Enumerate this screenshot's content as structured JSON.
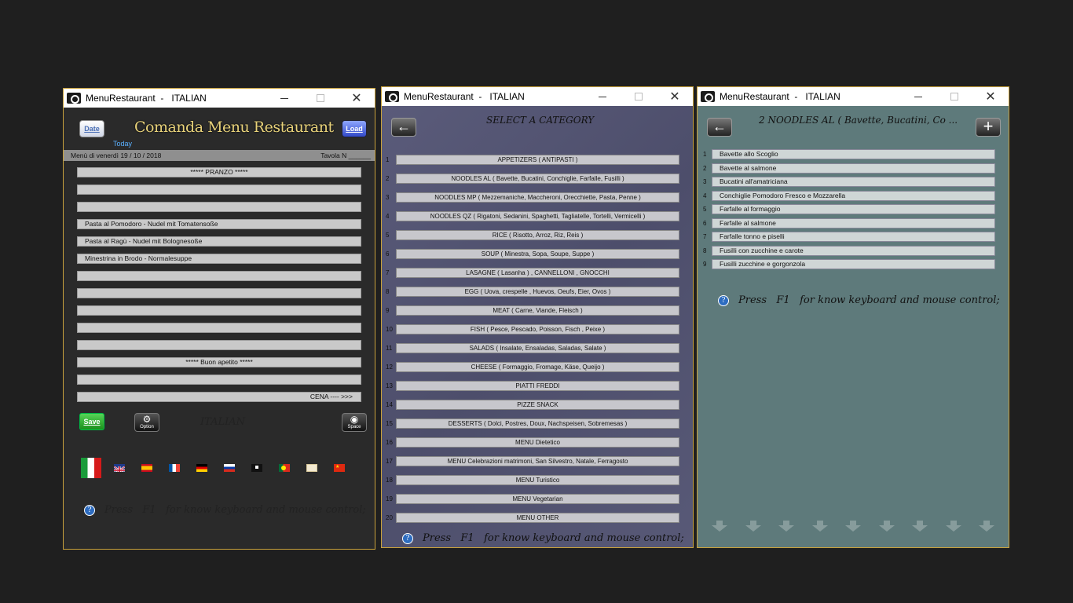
{
  "window_left": {
    "title": "MenuRestaurant  -   ITALIAN",
    "date_button": "Date",
    "load_button": "Load",
    "app_title": "Comanda Menu Restaurant",
    "today_label": "Today",
    "info_left": "Menù di  venerdì  19 / 10 / 2018",
    "info_right": "Tavola N ______",
    "menu_lines": [
      "***** PRANZO *****",
      "",
      "",
      "Pasta al Pomodoro - Nudel mit Tomatensoße",
      "Pasta al Ragù - Nudel mit Bolognesoße",
      "Minestrina in Brodo - Normalesuppe",
      "",
      "",
      "",
      "",
      "",
      "*****  Buon apetito  *****",
      "",
      "CENA  ---- >>>"
    ],
    "save_button": "Save",
    "option_button": "Option",
    "space_button": "Space",
    "language_label": "ITALIAN",
    "flags": [
      "italy-flag",
      "uk-flag",
      "spain-flag",
      "france-flag",
      "germany-flag",
      "russia-flag",
      "arabic-flag",
      "portugal-flag",
      "greece-flag",
      "china-flag"
    ],
    "help_text": "Press   F1   for know keyboard and mouse control;"
  },
  "window_middle": {
    "title": "MenuRestaurant  -   ITALIAN",
    "heading": "SELECT A CATEGORY",
    "categories": [
      {
        "num": "1",
        "label": "APPETIZERS ( ANTIPASTI )"
      },
      {
        "num": "2",
        "label": "NOODLES  AL  ( Bavette, Bucatini, Conchiglie, Farfalle, Fusilli )"
      },
      {
        "num": "3",
        "label": "NOODLES  MP  ( Mezzemaniche, Maccheroni, Orecchiette, Pasta, Penne )"
      },
      {
        "num": "4",
        "label": "NOODLES  QZ  ( Rigatoni, Sedanini, Spaghetti, Tagliatelle, Tortelli, Vermicelli )"
      },
      {
        "num": "5",
        "label": "RICE ( Risotto, Arroz, Riz, Reis )"
      },
      {
        "num": "6",
        "label": "SOUP ( Minestra, Sopa, Soupe, Suppe )"
      },
      {
        "num": "7",
        "label": "LASAGNE ( Lasanha ) , CANNELLONI  , GNOCCHI"
      },
      {
        "num": "8",
        "label": "EGG ( Uova, crespelle , Huevos, Oeufs, Eier, Ovos )"
      },
      {
        "num": "9",
        "label": "MEAT   ( Carne, Viande, Fleisch )"
      },
      {
        "num": "10",
        "label": "FISH   ( Pesce, Pescado, Poisson, Fisch , Peixe )"
      },
      {
        "num": "11",
        "label": "SALADS ( Insalate, Ensaladas, Saladas, Salate )"
      },
      {
        "num": "12",
        "label": "CHEESE ( Formaggio, Fromage, Käse, Queijo )"
      },
      {
        "num": "13",
        "label": "PIATTI FREDDI"
      },
      {
        "num": "14",
        "label": "PIZZE  SNACK"
      },
      {
        "num": "15",
        "label": "DESSERTS ( Dolci, Postres, Doux, Nachspeisen, Sobremesas )"
      },
      {
        "num": "16",
        "label": "MENU Dietetico"
      },
      {
        "num": "17",
        "label": "MENU Celebrazioni  matrimoni, San Silvestro, Natale, Ferragosto"
      },
      {
        "num": "18",
        "label": "MENU Turistico"
      },
      {
        "num": "19",
        "label": "MENU Vegetarian"
      },
      {
        "num": "20",
        "label": "MENU OTHER"
      }
    ],
    "help_text": "Press   F1   for know keyboard and mouse control;"
  },
  "window_right": {
    "title": "MenuRestaurant  -   ITALIAN",
    "heading": "2   NOODLES  AL  ( Bavette, Bucatini, Co ...",
    "dishes": [
      {
        "num": "1",
        "label": "Bavette allo Scoglio"
      },
      {
        "num": "2",
        "label": "Bavette al salmone"
      },
      {
        "num": "3",
        "label": "Bucatini all'amatriciana"
      },
      {
        "num": "4",
        "label": "Conchiglie Pomodoro Fresco e Mozzarella"
      },
      {
        "num": "5",
        "label": "Farfalle al formaggio"
      },
      {
        "num": "6",
        "label": "Farfalle al salmone"
      },
      {
        "num": "7",
        "label": "Farfalle tonno e piselli"
      },
      {
        "num": "8",
        "label": "Fusilli con zucchine e carote"
      },
      {
        "num": "9",
        "label": "Fusilli zucchine e gorgonzola"
      }
    ],
    "help_text": "Press   F1   for know keyboard and mouse control;"
  }
}
